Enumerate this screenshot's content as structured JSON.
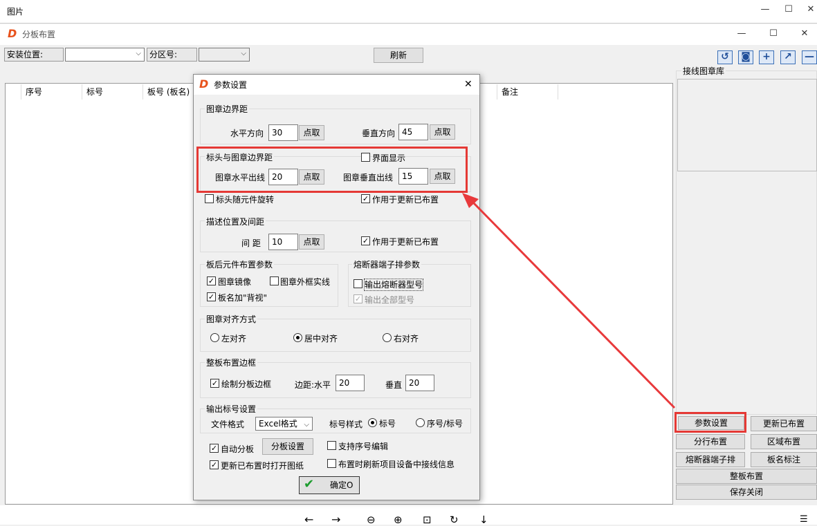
{
  "outer": {
    "title": "图片",
    "min": "—",
    "max": "☐",
    "close": "✕"
  },
  "app": {
    "title": "分板布置",
    "min": "—",
    "max": "☐",
    "close": "✕"
  },
  "top": {
    "install_label": "安装位置:",
    "zone_label": "分区号:",
    "refresh": "刷新"
  },
  "table": {
    "headers": [
      "序号",
      "标号",
      "板号 (板名)",
      "备注"
    ]
  },
  "library": {
    "title": "接线图章库"
  },
  "right_buttons": {
    "param": "参数设置",
    "update": "更新已布置",
    "row": "分行布置",
    "area": "区域布置",
    "fuse": "熔断器端子排",
    "board_label": "板名标注",
    "whole": "整板布置",
    "save_close": "保存关闭"
  },
  "dialog": {
    "title": "参数设置",
    "close": "✕",
    "stamp_margin": {
      "title": "图章边界距",
      "h_label": "水平方向",
      "h_value": "30",
      "v_label": "垂直方向",
      "v_value": "45",
      "pick": "点取"
    },
    "header_margin": {
      "title": "标头与图章边界距",
      "show_label": "界面显示",
      "h_label": "图章水平出线",
      "h_value": "20",
      "v_label": "图章垂直出线",
      "v_value": "15",
      "pick": "点取"
    },
    "rotate_label": "标头随元件旋转",
    "apply_label": "作用于更新已布置",
    "desc": {
      "title": "描述位置及间距",
      "gap_label": "间 距",
      "gap_value": "10",
      "pick": "点取",
      "apply_label": "作用于更新已布置"
    },
    "back": {
      "title": "板后元件布置参数",
      "mirror": "图章镜像",
      "frame": "图章外框实线",
      "backview": "板名加\"背视\""
    },
    "fuse": {
      "title": "熔断器端子排参数",
      "output_model": "输出熔断器型号",
      "output_all": "输出全部型号"
    },
    "align": {
      "title": "图章对齐方式",
      "left": "左对齐",
      "center": "居中对齐",
      "right": "右对齐"
    },
    "border": {
      "title": "整板布置边框",
      "draw": "绘制分板边框",
      "margin_label": "边距:水平",
      "margin_value": "20",
      "v_label": "垂直",
      "v_value": "20"
    },
    "output": {
      "title": "输出标号设置",
      "format_label": "文件格式",
      "format_value": "Excel格式",
      "style_label": "标号样式",
      "style1": "标号",
      "style2": "序号/标号"
    },
    "auto_split": "自动分板",
    "split_settings": "分板设置",
    "support_edit": "支持序号编辑",
    "open_drawing": "更新已布置时打开图纸",
    "refresh_info": "布置时刷新项目设备中接线信息",
    "ok": "确定O"
  },
  "bottom": {
    "prev": "←",
    "next": "→",
    "zoom_out": "⊖",
    "zoom_in": "⊕",
    "fit": "⊡",
    "rotate": "↻",
    "download": "↓"
  },
  "colors": {
    "highlight": "#e53935",
    "arrow": "#e8393b",
    "logo": "#e8521c"
  }
}
